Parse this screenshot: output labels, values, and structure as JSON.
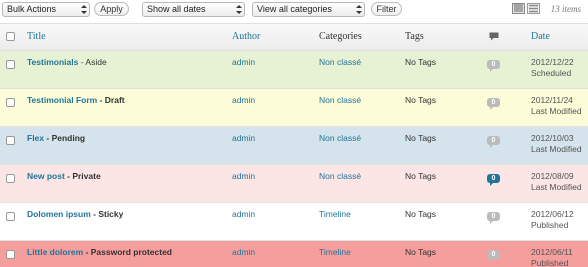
{
  "toolbar": {
    "bulk_actions": "Bulk Actions",
    "apply": "Apply",
    "dates": "Show all dates",
    "categories": "View all categories",
    "filter": "Filter",
    "items_count": "13 items"
  },
  "columns": {
    "title": "Title",
    "author": "Author",
    "categories": "Categories",
    "tags": "Tags",
    "date": "Date"
  },
  "rows": [
    {
      "title": "Testimonials",
      "state": " - Aside",
      "author": "admin",
      "category": "Non classé",
      "tags": "No Tags",
      "comments": "0",
      "date": "2012/12/22",
      "status": "Scheduled",
      "bg": "#e6f2d3"
    },
    {
      "title": "Testimonial Form",
      "state": " - Draft",
      "author": "admin",
      "category": "Non classé",
      "tags": "No Tags",
      "comments": "0",
      "date": "2012/11/24",
      "status": "Last Modified",
      "bg": "#fcfcd8"
    },
    {
      "title": "Flex",
      "state": " - Pending",
      "author": "admin",
      "category": "Non classé",
      "tags": "No Tags",
      "comments": "0",
      "date": "2012/10/03",
      "status": "Last Modified",
      "bg": "#d4e3ec"
    },
    {
      "title": "New post",
      "state": " - Private",
      "author": "admin",
      "category": "Non classé",
      "tags": "No Tags",
      "comments": "0",
      "date": "2012/08/09",
      "status": "Last Modified",
      "bg": "#fbe5e5"
    },
    {
      "title": "Dolomen ipsum",
      "state": " - Sticky",
      "author": "admin",
      "category": "Timeline",
      "tags": "No Tags",
      "comments": "0",
      "date": "2012/06/12",
      "status": "Published",
      "bg": "#ffffff"
    },
    {
      "title": "Little dolorem",
      "state": " - Password protected",
      "author": "admin",
      "category": "Timeline",
      "tags": "No Tags",
      "comments": "0",
      "date": "2012/06/11",
      "status": "Published",
      "bg": "#f49e9e"
    }
  ]
}
